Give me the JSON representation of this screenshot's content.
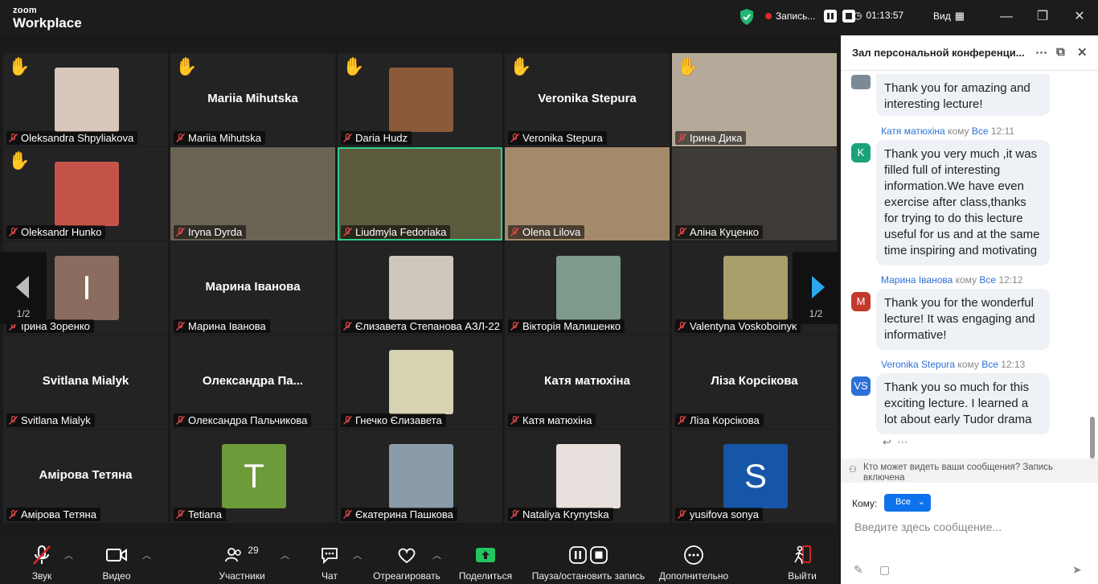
{
  "app": {
    "logo_top": "zoom",
    "logo_bottom": "Workplace"
  },
  "topbar": {
    "record_label": "Запись...",
    "timer": "01:13:57",
    "view_label": "Вид"
  },
  "tiles": [
    {
      "name": "Oleksandra Shpyliakova",
      "hand": true,
      "kind": "photo",
      "color": "#d9c7bd"
    },
    {
      "name": "Mariia Mihutska",
      "hand": true,
      "kind": "name",
      "big": "Mariia Mihutska"
    },
    {
      "name": "Daria Hudz",
      "hand": true,
      "kind": "photo",
      "color": "#8a5a3a"
    },
    {
      "name": "Veronika Stepura",
      "hand": true,
      "kind": "name",
      "big": "Veronika Stepura"
    },
    {
      "name": "Ірина Дика",
      "hand": true,
      "kind": "video",
      "color": "#b5a99a"
    },
    {
      "name": "Oleksandr Hunko",
      "hand": true,
      "kind": "photo",
      "color": "#c4544a"
    },
    {
      "name": "Iryna Dyrda",
      "hand": false,
      "kind": "video",
      "color": "#6b6455"
    },
    {
      "name": "Liudmyla Fedoriaka",
      "hand": false,
      "kind": "video",
      "color": "#5c5a3c",
      "active": true
    },
    {
      "name": "Olena Lilova",
      "hand": false,
      "kind": "video",
      "color": "#a38a6b"
    },
    {
      "name": "Аліна Куценко",
      "hand": false,
      "kind": "video",
      "color": "#3e3a36"
    },
    {
      "name": "Ірина Зоренко",
      "hand": false,
      "kind": "letter",
      "letter": "I",
      "color": "#8a6d5f"
    },
    {
      "name": "Марина Іванова",
      "hand": false,
      "kind": "name",
      "big": "Марина Іванова"
    },
    {
      "name": "Єлизавета Степанова АЗЛ-22",
      "hand": false,
      "kind": "photo",
      "color": "#cfc6bd"
    },
    {
      "name": "Вікторія Малишенко",
      "hand": false,
      "kind": "photo",
      "color": "#7e9a8c"
    },
    {
      "name": "Valentyna Voskoboinyk",
      "hand": false,
      "kind": "photo",
      "color": "#a89e6a"
    },
    {
      "name": "Svitlana Mialyk",
      "hand": false,
      "kind": "name",
      "big": "Svitlana Mialyk"
    },
    {
      "name": "Олександра Пальчикова",
      "hand": false,
      "kind": "name",
      "big": "Олександра  Па..."
    },
    {
      "name": "Гнечко Єлизавета",
      "hand": false,
      "kind": "photo",
      "color": "#d6d2b2"
    },
    {
      "name": "Катя матюхіна",
      "hand": false,
      "kind": "name",
      "big": "Катя матюхіна"
    },
    {
      "name": "Ліза Корсікова",
      "hand": false,
      "kind": "name",
      "big": "Ліза Корсікова"
    },
    {
      "name": "Амірова Тетяна",
      "hand": false,
      "kind": "name",
      "big": "Амірова Тетяна"
    },
    {
      "name": "Tetiana",
      "hand": false,
      "kind": "letter",
      "letter": "T",
      "color": "#6d9b3a"
    },
    {
      "name": "Єкатерина Пашкова",
      "hand": false,
      "kind": "photo",
      "color": "#8b9ba8"
    },
    {
      "name": "Nataliya Krynytska",
      "hand": false,
      "kind": "photo",
      "color": "#e8e0dc"
    },
    {
      "name": "yusifova sonya",
      "hand": false,
      "kind": "letter",
      "letter": "S",
      "color": "#1656a8"
    }
  ],
  "pager": {
    "left": "1/2",
    "right": "1/2"
  },
  "toolbar": {
    "sound": "Звук",
    "video": "Видео",
    "participants": "Участники",
    "participants_count": "29",
    "chat": "Чат",
    "react": "Отреагировать",
    "share": "Поделиться",
    "record": "Пауза/остановить запись",
    "more": "Дополнительно",
    "leave": "Выйти"
  },
  "chat": {
    "title": "Зал персональной конференци...",
    "to_word": "кому",
    "messages": [
      {
        "sender": "",
        "to": "",
        "time": "",
        "text": "Thank you for amazing and interesting lecture!",
        "avatar": "",
        "avatar_color": "#ffffff"
      },
      {
        "sender": "Катя матюхіна",
        "to": "Все",
        "time": "12:11",
        "text": "Thank you very much ,it was filled full of interesting information.We have even exercise after class,thanks for trying to do this lecture useful for us and at the same time inspiring and motivating",
        "avatar": "K",
        "avatar_color": "#1aa37a"
      },
      {
        "sender": "Марина Іванова",
        "to": "Все",
        "time": "12:12",
        "text": "Thank you for the wonderful lecture! It was engaging and informative!",
        "avatar": "M",
        "avatar_color": "#c2392b"
      },
      {
        "sender": "Veronika Stepura",
        "to": "Все",
        "time": "12:13",
        "text": "Thank you so much for this exciting lecture. I learned a lot about early Tudor drama",
        "avatar": "VS",
        "avatar_color": "#2d6fd6"
      }
    ],
    "who_can_see": "Кто может видеть ваши сообщения? Запись включена",
    "to_label": "Кому:",
    "to_value": "Все",
    "placeholder": "Введите здесь сообщение..."
  },
  "colors": {
    "accent": "#0e72ed",
    "active_speaker": "#2fd08c",
    "record": "#e02828"
  }
}
